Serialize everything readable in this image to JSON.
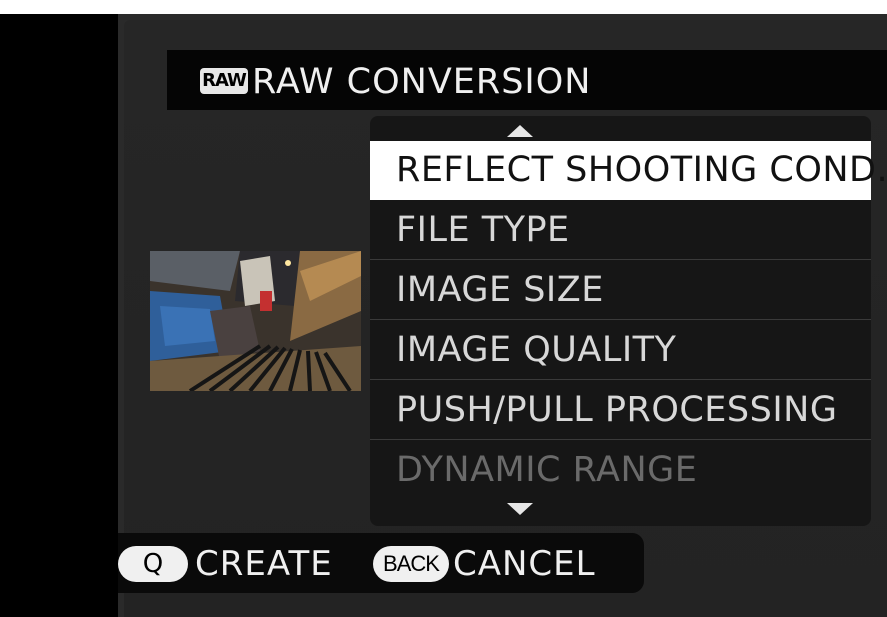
{
  "header": {
    "badge": "RAW",
    "title": "RAW CONVERSION"
  },
  "menu": {
    "items": [
      {
        "label": "REFLECT SHOOTING COND.",
        "state": "selected"
      },
      {
        "label": "FILE TYPE",
        "state": "normal"
      },
      {
        "label": "IMAGE SIZE",
        "state": "normal"
      },
      {
        "label": "IMAGE QUALITY",
        "state": "normal"
      },
      {
        "label": "PUSH/PULL PROCESSING",
        "state": "normal"
      },
      {
        "label": "DYNAMIC RANGE",
        "state": "dimmed"
      }
    ],
    "scroll_up_icon": "triangle-up-icon",
    "scroll_down_icon": "triangle-down-icon"
  },
  "footer": {
    "q_key": "Q",
    "create_label": "CREATE",
    "back_key": "BACK",
    "cancel_label": "CANCEL"
  },
  "colors": {
    "selected_bg": "#ffffff",
    "panel_bg": "#161616",
    "screen_bg": "#262626"
  }
}
